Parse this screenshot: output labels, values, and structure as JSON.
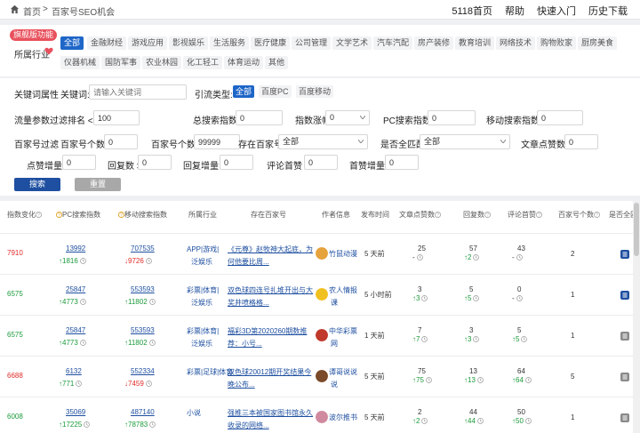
{
  "breadcrumb": {
    "home": "首页",
    "current": "百家号SEO机会"
  },
  "topnav": [
    "5118首页",
    "帮助",
    "快速入门",
    "历史下载"
  ],
  "flag_label": "旗舰版功能",
  "industry_label": "所属行业",
  "categories": [
    "全部",
    "金融财经",
    "游戏应用",
    "影视娱乐",
    "生活服务",
    "医疗健康",
    "公司管理",
    "文学艺术",
    "汽车汽配",
    "房产装修",
    "教育培训",
    "网络技术",
    "购物败家",
    "厨房美食",
    "仪器机械",
    "国防军事",
    "农业林园",
    "化工轻工",
    "体育运动",
    "其他"
  ],
  "filters": {
    "keyword_group": "关键词属性",
    "keyword_label": "关键词:",
    "keyword_placeholder": "请输入关键词",
    "traffic_type_label": "引流类型:",
    "traffic_types": [
      "全部",
      "百度PC",
      "百度移动"
    ],
    "traffic_group": "流量参数过滤",
    "rank_label": "排名 <=",
    "rank_value": "100",
    "total_search_label": "总搜索指数 >",
    "total_search_value": "0",
    "growth_label": "指数涨幅",
    "growth_value": "0",
    "pc_search_label": "PC搜索指数 >",
    "pc_search_value": "0",
    "mobile_search_label": "移动搜索指数 >",
    "mobile_search_value": "0",
    "bjh_group": "百家号过滤",
    "bjh_count_label": "百家号个数 >",
    "bjh_count_value": "0",
    "bjh_count_lt_label": "百家号个数 <",
    "bjh_count_lt_value": "99999",
    "exists_label": "存在百家号",
    "exists_value": "全部",
    "full_match_label": "是否全匹配",
    "full_match_value": "全部",
    "article_likes_label": "文章点赞数 >",
    "article_likes_value": "0",
    "like_growth_label": "点赞增量 >",
    "like_growth_value": "0",
    "reply_label": "回复数 >",
    "reply_value": "0",
    "reply_growth_label": "回复增量 >",
    "reply_growth_value": "0",
    "comment_top_label": "评论首赞 >",
    "comment_top_value": "0",
    "first_like_growth_label": "首赞增量 >",
    "first_like_growth_value": "0",
    "search_button": "搜索",
    "reset_button": "重置"
  },
  "columns": [
    "指数变化",
    "PC搜索指数",
    "移动搜索指数",
    "所属行业",
    "存在百家号",
    "作者信息",
    "发布时间",
    "文章点赞数",
    "回复数",
    "评论首赞",
    "百家号个数",
    "是否全匹配"
  ],
  "rows": [
    {
      "change": "7910",
      "change_color": "#e02b2b",
      "pc": "13992",
      "pc_delta": "1816",
      "pc_dir": "up",
      "mobile": "707535",
      "mobile_delta": "9726",
      "mobile_dir": "down",
      "industry1": "APP|游戏|",
      "industry2": "泛娱乐",
      "title1": "《元尊》赵牧神大起底，为",
      "title2": "何他要比周...",
      "author": "竹鼠动漫",
      "time": "5 天前",
      "likes": "25",
      "likes_delta": "-",
      "likes_dir": "none",
      "replies": "57",
      "replies_delta": "2",
      "replies_dir": "up",
      "top": "43",
      "top_delta": "-",
      "top_dir": "none",
      "count": "2",
      "match_icon": "match-yes"
    },
    {
      "change": "6575",
      "change_color": "#1a9a3a",
      "pc": "25847",
      "pc_delta": "4773",
      "pc_dir": "up",
      "mobile": "553593",
      "mobile_delta": "11802",
      "mobile_dir": "up",
      "industry1": "彩票|体育|",
      "industry2": "泛娱乐",
      "title1": "双色球四连号扎堆开出与大",
      "title2": "奖井喷格格...",
      "author": "农人情报",
      "author2": "课",
      "time": "5 小时前",
      "likes": "3",
      "likes_delta": "3",
      "likes_dir": "up",
      "replies": "5",
      "replies_delta": "5",
      "replies_dir": "up",
      "top": "0",
      "top_delta": "-",
      "top_dir": "none",
      "count": "1",
      "match_icon": "match-yes"
    },
    {
      "change": "6575",
      "change_color": "#1a9a3a",
      "pc": "25847",
      "pc_delta": "4773",
      "pc_dir": "up",
      "mobile": "553593",
      "mobile_delta": "11802",
      "mobile_dir": "up",
      "industry1": "彩票|体育|",
      "industry2": "泛娱乐",
      "title1": "福彩3D第2020260期数推",
      "title2": "荐：小号...",
      "author": "中华彩票",
      "author2": "网",
      "time": "1 天前",
      "likes": "7",
      "likes_delta": "7",
      "likes_dir": "up",
      "replies": "3",
      "replies_delta": "3",
      "replies_dir": "up",
      "top": "5",
      "top_delta": "5",
      "top_dir": "up",
      "count": "1",
      "match_icon": "match-no"
    },
    {
      "change": "6688",
      "change_color": "#e02b2b",
      "pc": "6132",
      "pc_delta": "771",
      "pc_dir": "up",
      "mobile": "552334",
      "mobile_delta": "7459",
      "mobile_dir": "down",
      "industry1": "彩票|足球|体育",
      "industry2": "",
      "title1": "双色球20012期开奖结果今",
      "title2": "晚公布...",
      "author": "谭哥说说",
      "author2": "说",
      "time": "5 天前",
      "likes": "75",
      "likes_delta": "75",
      "likes_dir": "up",
      "replies": "13",
      "replies_delta": "13",
      "replies_dir": "up",
      "top": "64",
      "top_delta": "64",
      "top_dir": "up",
      "count": "5",
      "match_icon": "match-no"
    },
    {
      "change": "6008",
      "change_color": "#1a9a3a",
      "pc": "35069",
      "pc_delta": "17225",
      "pc_dir": "up",
      "mobile": "487140",
      "mobile_delta": "78783",
      "mobile_dir": "up",
      "industry1": "小说",
      "industry2": "",
      "title1": "强推三本被国家图书馆永久",
      "title2": "收录的网络...",
      "author": "波尔推书",
      "author2": "",
      "time": "5 天前",
      "likes": "2",
      "likes_delta": "2",
      "likes_dir": "up",
      "replies": "44",
      "replies_delta": "44",
      "replies_dir": "up",
      "top": "50",
      "top_delta": "50",
      "top_dir": "up",
      "count": "1",
      "match_icon": "match-no"
    }
  ]
}
